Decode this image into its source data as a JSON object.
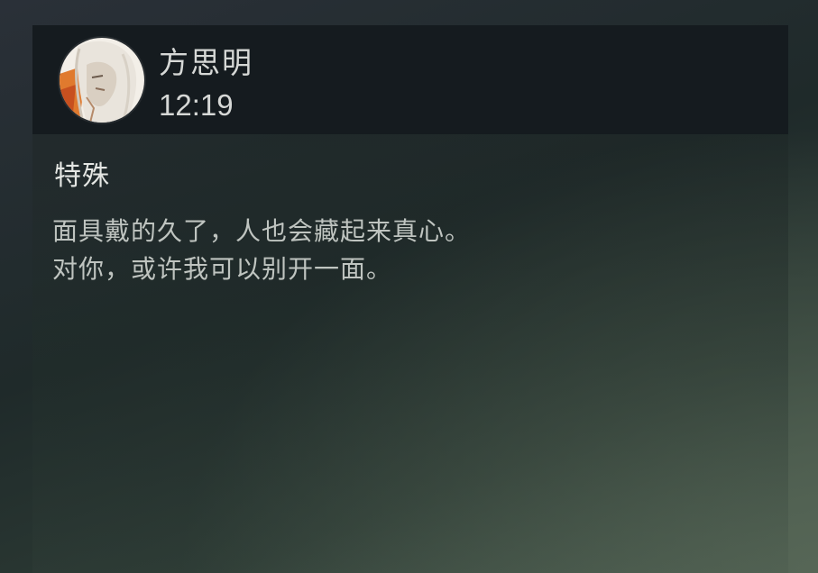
{
  "message": {
    "sender": {
      "name": "方思明",
      "time": "12:19",
      "avatar": "character-portrait-avatar"
    },
    "subject": "特殊",
    "body_lines": [
      "面具戴的久了，人也会藏起来真心。",
      "对你，或许我可以别开一面。"
    ]
  },
  "colors": {
    "header_bg": "#151b1f",
    "text_primary": "#e4e6e3",
    "text_secondary": "#bfc4c0",
    "avatar_accent": "#e07a2e"
  }
}
